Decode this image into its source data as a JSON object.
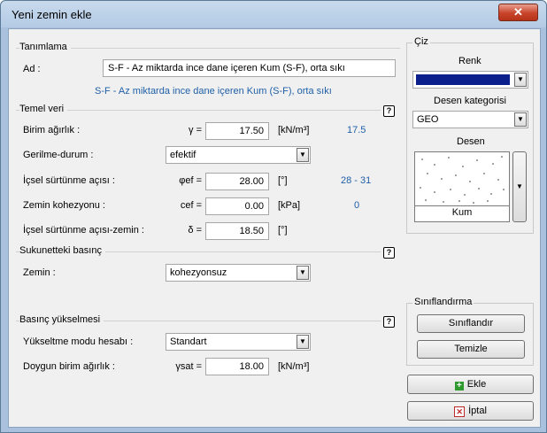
{
  "window": {
    "title": "Yeni zemin ekle",
    "close_glyph": "✕"
  },
  "identification": {
    "section_title": "Tanımlama",
    "name_label": "Ad :",
    "name_value": "S-F - Az miktarda ince dane içeren Kum (S-F), orta sıkı",
    "name_hint": "S-F - Az miktarda ince dane içeren Kum (S-F), orta sıkı"
  },
  "basic": {
    "section_title": "Temel veri",
    "help_glyph": "?",
    "unit_weight": {
      "label": "Birim ağırlık :",
      "symbol": "γ =",
      "value": "17.50",
      "unit": "[kN/m³]",
      "hint": "17.5"
    },
    "stress_state": {
      "label": "Gerilme-durum :",
      "value": "efektif"
    },
    "friction_angle": {
      "label": "İçsel sürtünme açısı :",
      "symbol": "φef =",
      "value": "28.00",
      "unit": "[°]",
      "hint": "28 - 31"
    },
    "cohesion": {
      "label": "Zemin kohezyonu :",
      "symbol": "cef =",
      "value": "0.00",
      "unit": "[kPa]",
      "hint": "0"
    },
    "interface_friction": {
      "label": "İçsel sürtünme açısı-zemin :",
      "symbol": "δ =",
      "value": "18.50",
      "unit": "[°]"
    }
  },
  "rest_pressure": {
    "section_title": "Sukunetteki basınç",
    "help_glyph": "?",
    "soil_label": "Zemin :",
    "soil_value": "kohezyonsuz"
  },
  "uplift": {
    "section_title": "Basınç yükselmesi",
    "help_glyph": "?",
    "mode_label": "Yükseltme modu hesabı :",
    "mode_value": "Standart",
    "sat_label": "Doygun birim ağırlık :",
    "sat_symbol": "γsat =",
    "sat_value": "18.00",
    "sat_unit": "[kN/m³]"
  },
  "draw": {
    "group_title": "Çiz",
    "color_label": "Renk",
    "color_value": "#0a1f8c",
    "pattern_category_label": "Desen kategorisi",
    "pattern_category_value": "GEO",
    "pattern_label": "Desen",
    "pattern_name": "Kum"
  },
  "classification": {
    "group_title": "Sınıflandırma",
    "classify_button": "Sınıflandır",
    "clear_button": "Temizle"
  },
  "actions": {
    "add_button": "Ekle",
    "cancel_button": "İptal",
    "add_icon_color": "#2e9a2e",
    "cancel_icon_color": "#c0282a"
  }
}
